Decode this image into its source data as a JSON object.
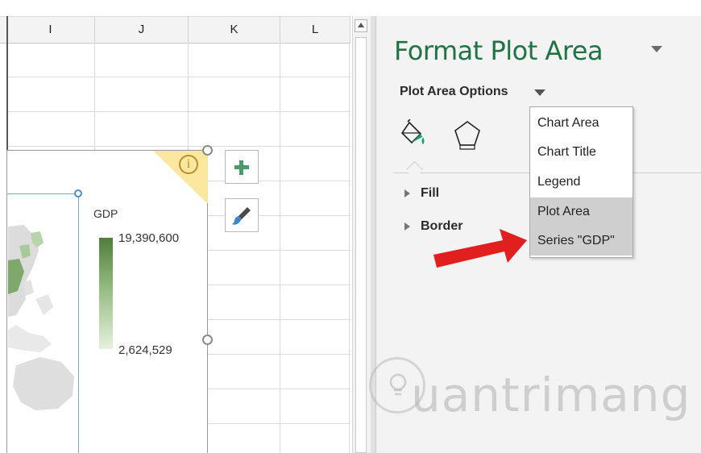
{
  "sheet": {
    "columns": [
      "I",
      "J",
      "K",
      "L"
    ]
  },
  "chart": {
    "info_icon": "i",
    "legend": {
      "title": "GDP",
      "max_label": "19,390,600",
      "min_label": "2,624,529"
    },
    "buttons": {
      "plus_icon": "plus-icon",
      "brush_icon": "paintbrush-icon"
    }
  },
  "pane": {
    "title": "Format Plot Area",
    "options_label": "Plot Area Options",
    "tabs": [
      "fill-line-icon",
      "effects-pentagon-icon"
    ],
    "sections": [
      {
        "label": "Fill"
      },
      {
        "label": "Border"
      }
    ],
    "dropdown": {
      "items": [
        {
          "label": "Chart Area"
        },
        {
          "label": "Chart Title"
        },
        {
          "label": "Legend"
        },
        {
          "label": "Plot Area",
          "selected": true
        },
        {
          "label": "Series \"GDP\"",
          "highlighted": true
        }
      ]
    }
  },
  "watermark": {
    "text": "uantrimang"
  },
  "colors": {
    "pane_title": "#217346",
    "arrow": "#e21f1f",
    "legend_dark": "#507e3a",
    "legend_light": "#e6f1de"
  }
}
